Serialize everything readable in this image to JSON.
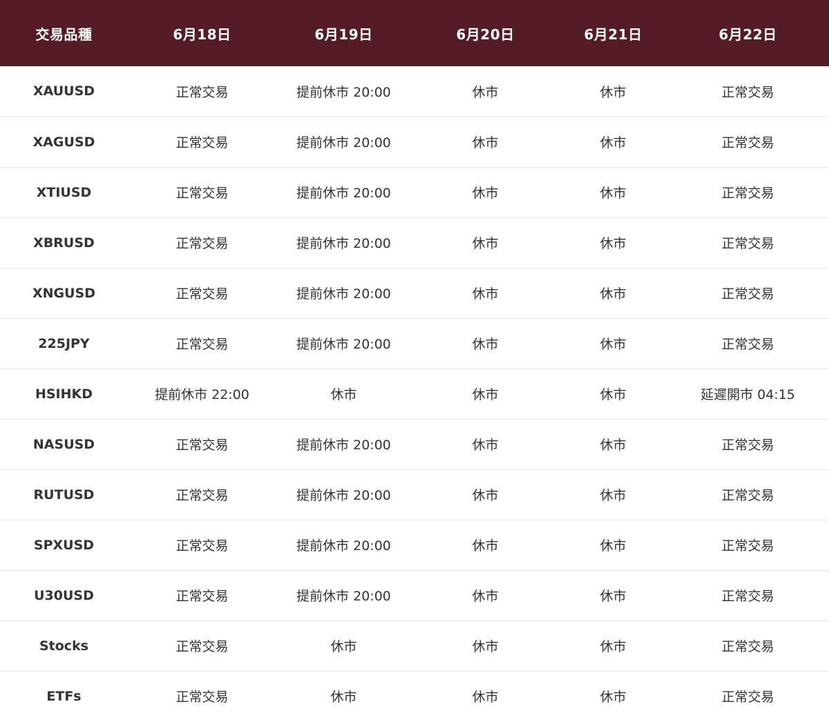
{
  "table": {
    "headers": [
      "交易品種",
      "6月18日",
      "6月19日",
      "6月20日",
      "6月21日",
      "6月22日"
    ],
    "rows": [
      [
        "XAUUSD",
        "正常交易",
        "提前休市 20:00",
        "休市",
        "休市",
        "正常交易"
      ],
      [
        "XAGUSD",
        "正常交易",
        "提前休市 20:00",
        "休市",
        "休市",
        "正常交易"
      ],
      [
        "XTIUSD",
        "正常交易",
        "提前休市 20:00",
        "休市",
        "休市",
        "正常交易"
      ],
      [
        "XBRUSD",
        "正常交易",
        "提前休市 20:00",
        "休市",
        "休市",
        "正常交易"
      ],
      [
        "XNGUSD",
        "正常交易",
        "提前休市 20:00",
        "休市",
        "休市",
        "正常交易"
      ],
      [
        "225JPY",
        "正常交易",
        "提前休市 20:00",
        "休市",
        "休市",
        "正常交易"
      ],
      [
        "HSIHKD",
        "提前休市 22:00",
        "休市",
        "休市",
        "休市",
        "延遲開市 04:15"
      ],
      [
        "NASUSD",
        "正常交易",
        "提前休市 20:00",
        "休市",
        "休市",
        "正常交易"
      ],
      [
        "RUTUSD",
        "正常交易",
        "提前休市 20:00",
        "休市",
        "休市",
        "正常交易"
      ],
      [
        "SPXUSD",
        "正常交易",
        "提前休市 20:00",
        "休市",
        "休市",
        "正常交易"
      ],
      [
        "U30USD",
        "正常交易",
        "提前休市 20:00",
        "休市",
        "休市",
        "正常交易"
      ],
      [
        "Stocks",
        "正常交易",
        "休市",
        "休市",
        "休市",
        "正常交易"
      ],
      [
        "ETFs",
        "正常交易",
        "休市",
        "休市",
        "休市",
        "正常交易"
      ]
    ]
  },
  "colors": {
    "header_background": "#531c26",
    "header_text": "#ffffff",
    "body_text": "#333333",
    "row_divider": "#e6e6e6"
  }
}
